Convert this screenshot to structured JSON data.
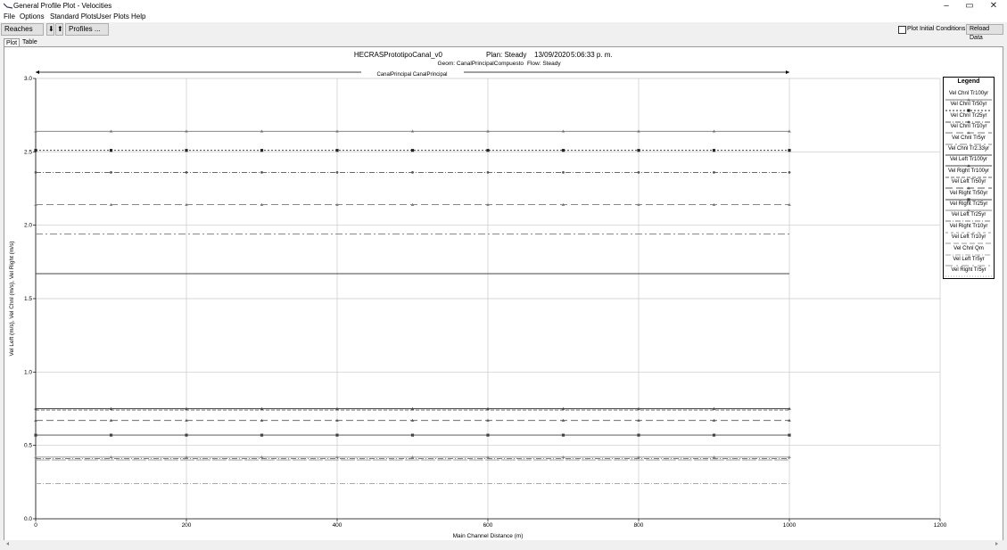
{
  "window": {
    "title": "General Profile Plot - Velocities",
    "minimize": "–",
    "restore": "▭",
    "close": "✕"
  },
  "menu": [
    {
      "label": "File"
    },
    {
      "label": "Options"
    },
    {
      "label": "Standard Plots"
    },
    {
      "label": "User Plots"
    },
    {
      "label": "Help"
    }
  ],
  "toolbar": {
    "reaches_label": "Reaches ...",
    "down_arrow": "⬇",
    "up_arrow": "⬆",
    "profiles_label": "Profiles ...",
    "initial_conditions_label": "Plot Initial Conditions",
    "reload_label": "Reload Data"
  },
  "tabs": [
    {
      "label": "Plot",
      "active": true
    },
    {
      "label": "Table",
      "active": false
    }
  ],
  "plot_header": {
    "project": "HECRASPrototipoCanal_v0",
    "plan": "Plan: Steady",
    "date": "13/09/2020",
    "time": "5:06:33 p. m.",
    "geom": "Geom: CanalPrincipalCompuesto",
    "flow": "Flow: Steady",
    "reach_label": "CanalPrincipal CanalPrincipal"
  },
  "legend_title": "Legend",
  "chart_data": {
    "type": "line",
    "title": "",
    "xlabel": "Main Channel Distance (m)",
    "ylabel": "Vel Left (m/s), Vel Chnl (m/s), Vel Right (m/s)",
    "xlim": [
      0,
      1200
    ],
    "ylim": [
      0,
      3.0
    ],
    "xticks": [
      0,
      200,
      400,
      600,
      800,
      1000,
      1200
    ],
    "yticks": [
      0.0,
      0.5,
      1.0,
      1.5,
      2.0,
      2.5,
      3.0
    ],
    "ytick_labels": [
      "0.0",
      "0.5",
      "1.0",
      "1.5",
      "2.0",
      "2.5",
      "3.0"
    ],
    "grid": true,
    "legend_position": "right",
    "x": [
      0,
      100,
      200,
      300,
      400,
      500,
      600,
      700,
      800,
      900,
      1000
    ],
    "series": [
      {
        "name": "Vel Chnl Tr100yr",
        "values": [
          2.64,
          2.64,
          2.64,
          2.64,
          2.64,
          2.64,
          2.64,
          2.64,
          2.64,
          2.64,
          2.64
        ],
        "dash": "",
        "marker": "tri",
        "color": "#777777"
      },
      {
        "name": "Vel Chnl Tr50yr",
        "values": [
          2.51,
          2.51,
          2.51,
          2.51,
          2.51,
          2.51,
          2.51,
          2.51,
          2.51,
          2.51,
          2.51
        ],
        "dash": "2,2",
        "marker": "square",
        "color": "#222222"
      },
      {
        "name": "Vel Chnl Tr25yr",
        "values": [
          2.36,
          2.36,
          2.36,
          2.36,
          2.36,
          2.36,
          2.36,
          2.36,
          2.36,
          2.36,
          2.36
        ],
        "dash": "6,2,1,2",
        "marker": "circle",
        "color": "#555555"
      },
      {
        "name": "Vel Chnl Tr10yr",
        "values": [
          2.14,
          2.14,
          2.14,
          2.14,
          2.14,
          2.14,
          2.14,
          2.14,
          2.14,
          2.14,
          2.14
        ],
        "dash": "8,4",
        "marker": "tri",
        "color": "#777777"
      },
      {
        "name": "Vel Chnl Tr5yr",
        "values": [
          1.94,
          1.94,
          1.94,
          1.94,
          1.94,
          1.94,
          1.94,
          1.94,
          1.94,
          1.94,
          1.94
        ],
        "dash": "8,3,2,3",
        "marker": "",
        "color": "#888888"
      },
      {
        "name": "Vel Chnl Tr2.33yr",
        "values": [
          1.67,
          1.67,
          1.67,
          1.67,
          1.67,
          1.67,
          1.67,
          1.67,
          1.67,
          1.67,
          1.67
        ],
        "dash": "",
        "marker": "",
        "color": "#444444"
      },
      {
        "name": "Vel Left Tr100yr",
        "values": [
          0.75,
          0.75,
          0.75,
          0.75,
          0.75,
          0.75,
          0.75,
          0.75,
          0.75,
          0.75,
          0.75
        ],
        "dash": "",
        "marker": "tri",
        "color": "#444444"
      },
      {
        "name": "Vel Right Tr100yr",
        "values": [
          0.74,
          0.74,
          0.74,
          0.74,
          0.74,
          0.74,
          0.74,
          0.74,
          0.74,
          0.74,
          0.74
        ],
        "dash": "4,2",
        "marker": "",
        "color": "#666666"
      },
      {
        "name": "Vel Left Tr50yr",
        "values": [
          0.67,
          0.67,
          0.67,
          0.67,
          0.67,
          0.67,
          0.67,
          0.67,
          0.67,
          0.67,
          0.67
        ],
        "dash": "8,4",
        "marker": "tri",
        "color": "#555555"
      },
      {
        "name": "Vel Right Tr50yr",
        "values": [
          0.57,
          0.57,
          0.57,
          0.57,
          0.57,
          0.57,
          0.57,
          0.57,
          0.57,
          0.57,
          0.57
        ],
        "dash": "",
        "marker": "square",
        "color": "#444444"
      },
      {
        "name": "Vel Right Tr25yr",
        "values": [
          0.42,
          0.42,
          0.42,
          0.42,
          0.42,
          0.42,
          0.42,
          0.42,
          0.42,
          0.42,
          0.42
        ],
        "dash": "",
        "marker": "tri",
        "color": "#888888"
      },
      {
        "name": "Vel Left Tr25yr",
        "values": [
          0.41,
          0.41,
          0.41,
          0.41,
          0.41,
          0.41,
          0.41,
          0.41,
          0.41,
          0.41,
          0.41
        ],
        "dash": "6,2,1,2",
        "marker": "",
        "color": "#777777"
      },
      {
        "name": "Vel Right Tr10yr",
        "values": [
          0.4,
          0.4,
          0.4,
          0.4,
          0.4,
          0.4,
          0.4,
          0.4,
          0.4,
          0.4,
          0.4
        ],
        "dash": "3,3",
        "marker": "",
        "color": "#999999"
      },
      {
        "name": "Vel Left Tr10yr",
        "values": [
          0.4,
          0.4,
          0.4,
          0.4,
          0.4,
          0.4,
          0.4,
          0.4,
          0.4,
          0.4,
          0.4
        ],
        "dash": "6,3",
        "marker": "",
        "color": "#999999"
      },
      {
        "name": "Vel Chnl Qm",
        "values": [
          0.24,
          0.24,
          0.24,
          0.24,
          0.24,
          0.24,
          0.24,
          0.24,
          0.24,
          0.24,
          0.24
        ],
        "dash": "6,2,1,2",
        "marker": "",
        "color": "#aaaaaa"
      },
      {
        "name": "Vel Left Tr5yr",
        "values": [
          0.4,
          0.4,
          0.4,
          0.4,
          0.4,
          0.4,
          0.4,
          0.4,
          0.4,
          0.4,
          0.4
        ],
        "dash": "8,4,2,4",
        "marker": "",
        "color": "#999999"
      },
      {
        "name": "Vel Right Tr5yr",
        "values": [
          0.4,
          0.4,
          0.4,
          0.4,
          0.4,
          0.4,
          0.4,
          0.4,
          0.4,
          0.4,
          0.4
        ],
        "dash": "1,2",
        "marker": "",
        "color": "#aaaaaa"
      }
    ]
  }
}
